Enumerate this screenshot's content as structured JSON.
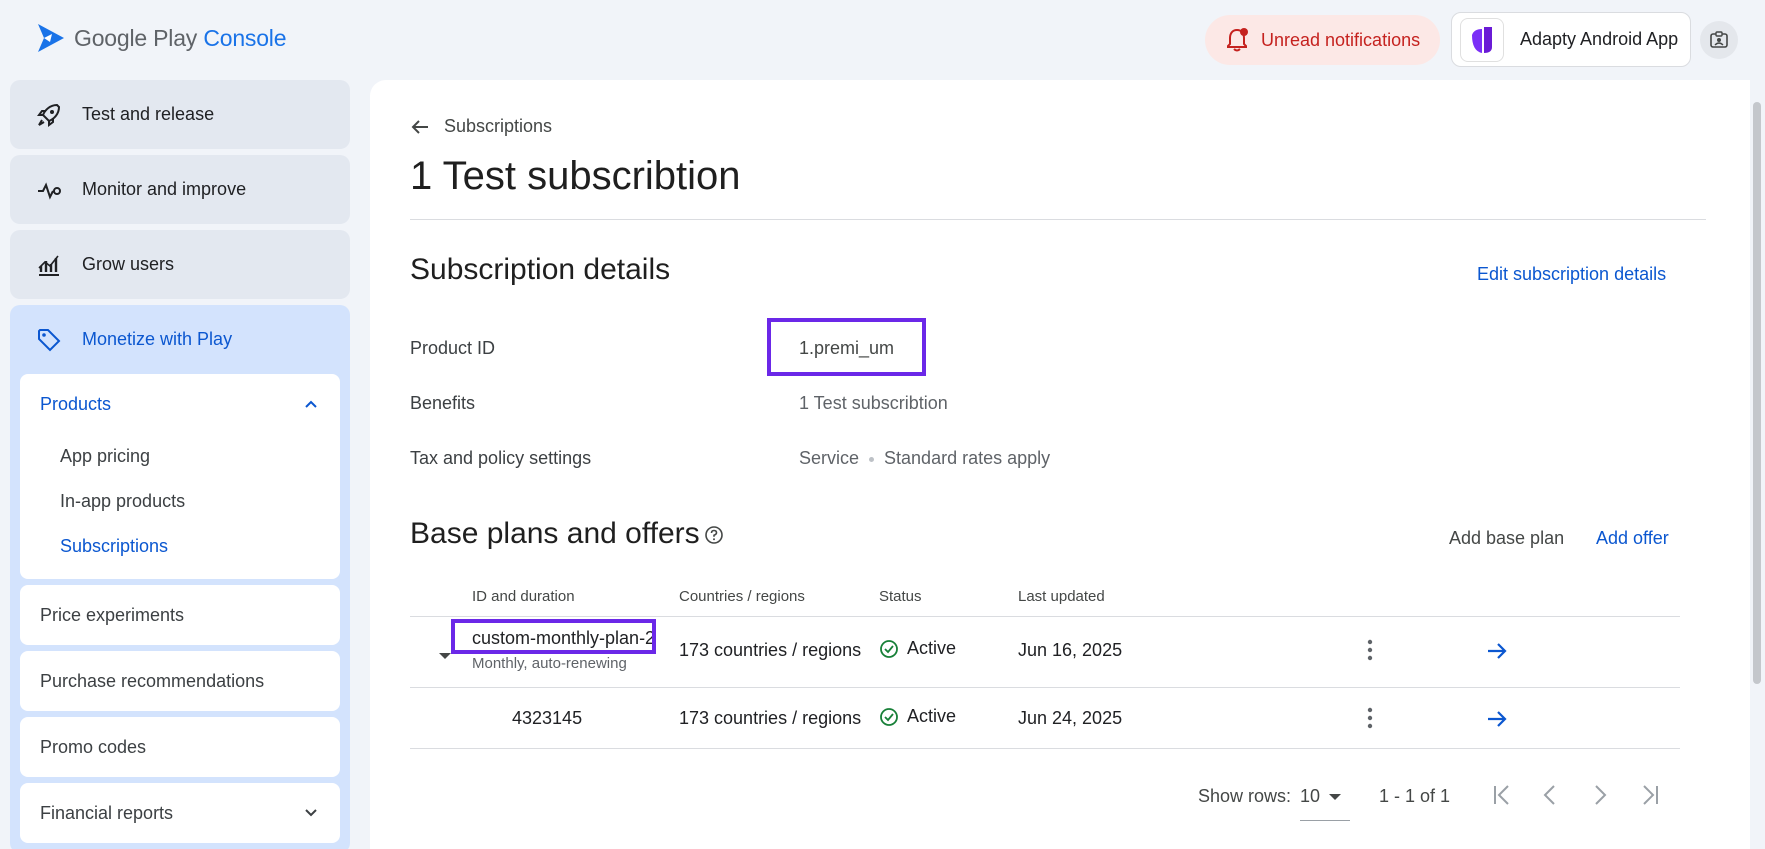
{
  "header": {
    "logo_google_play": "Google Play",
    "logo_console": "Console",
    "notifications_label": "Unread notifications",
    "app_name": "Adapty Android App"
  },
  "sidebar": {
    "main_items": [
      {
        "label": "Test and release",
        "icon": "rocket-icon"
      },
      {
        "label": "Monitor and improve",
        "icon": "pulse-icon"
      },
      {
        "label": "Grow users",
        "icon": "growth-chart-icon"
      },
      {
        "label": "Monetize with Play",
        "icon": "tag-icon"
      }
    ],
    "products": {
      "label": "Products",
      "items": [
        "App pricing",
        "In-app products",
        "Subscriptions"
      ]
    },
    "cards": [
      "Price experiments",
      "Purchase recommendations",
      "Promo codes",
      "Financial reports"
    ]
  },
  "main": {
    "breadcrumb": "Subscriptions",
    "title": "1 Test subscribtion",
    "details": {
      "heading": "Subscription details",
      "edit_link": "Edit subscription details",
      "product_id_label": "Product ID",
      "product_id_value": "1.premi_um",
      "benefits_label": "Benefits",
      "benefits_value": "1 Test subscribtion",
      "tax_label": "Tax and policy settings",
      "tax_value_1": "Service",
      "tax_value_2": "Standard rates apply"
    },
    "plans": {
      "heading": "Base plans and offers",
      "add_base_plan": "Add base plan",
      "add_offer": "Add offer",
      "columns": [
        "ID and duration",
        "Countries / regions",
        "Status",
        "Last updated"
      ],
      "rows": [
        {
          "id": "custom-monthly-plan-2",
          "duration": "Monthly, auto-renewing",
          "countries": "173 countries / regions",
          "status": "Active",
          "updated": "Jun 16, 2025"
        },
        {
          "id": "4323145",
          "duration": "",
          "countries": "173 countries / regions",
          "status": "Active",
          "updated": "Jun 24, 2025"
        }
      ],
      "pagination": {
        "show_rows_label": "Show rows:",
        "rows_value": "10",
        "range": "1 - 1 of 1"
      }
    }
  },
  "colors": {
    "accent": "#0b57d0",
    "highlight": "#6b28e8",
    "active_green": "#188038",
    "notification_red": "#c5221f"
  }
}
